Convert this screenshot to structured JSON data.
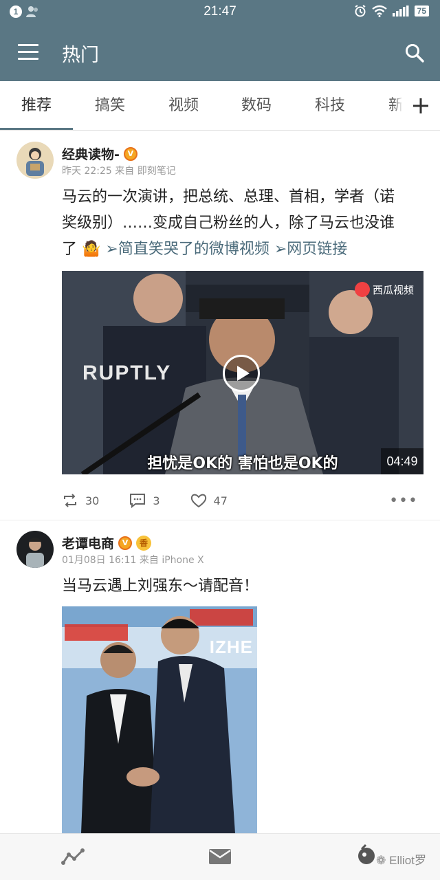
{
  "status_bar": {
    "notification_count": "1",
    "time": "21:47",
    "battery": "75"
  },
  "app_bar": {
    "title": "热门",
    "menu_icon": "hamburger-menu-icon",
    "search_icon": "search-icon"
  },
  "tabs": [
    "推荐",
    "搞笑",
    "视频",
    "数码",
    "科技",
    "新鲜"
  ],
  "active_tab": "推荐",
  "posts": [
    {
      "author": "经典读物-",
      "meta": "昨天 22:25 来自 即刻笔记",
      "text_lines": [
        "马云的一次演讲，把总统、总理、首相，学者（诺",
        "奖级别）……变成自己粉丝的人，除了马云也没谁"
      ],
      "text_line3_prefix": "了",
      "emoji": "🤷",
      "link1": "➢简直笑哭了的微博视频",
      "link2": "➢网页链接",
      "video": {
        "watermark_brand": "RUPTLY",
        "source_label": "西瓜视频",
        "subtitle": "担忧是OK的 害怕也是OK的",
        "duration": "04:49"
      },
      "reposts": "30",
      "comments": "3",
      "likes": "47"
    },
    {
      "author": "老谭电商",
      "meta": "01月08日 16:11 来自 iPhone X",
      "text": "当马云遇上刘强东～请配音！",
      "image_text": "IZHE"
    }
  ],
  "bottom_nav": {
    "items": [
      "trend-icon",
      "mail-icon",
      "profile-icon"
    ],
    "watermark": "Elliot罗"
  },
  "colors": {
    "primary": "#5a7784",
    "link": "#4a6a7a",
    "badge": "#f5a623"
  }
}
